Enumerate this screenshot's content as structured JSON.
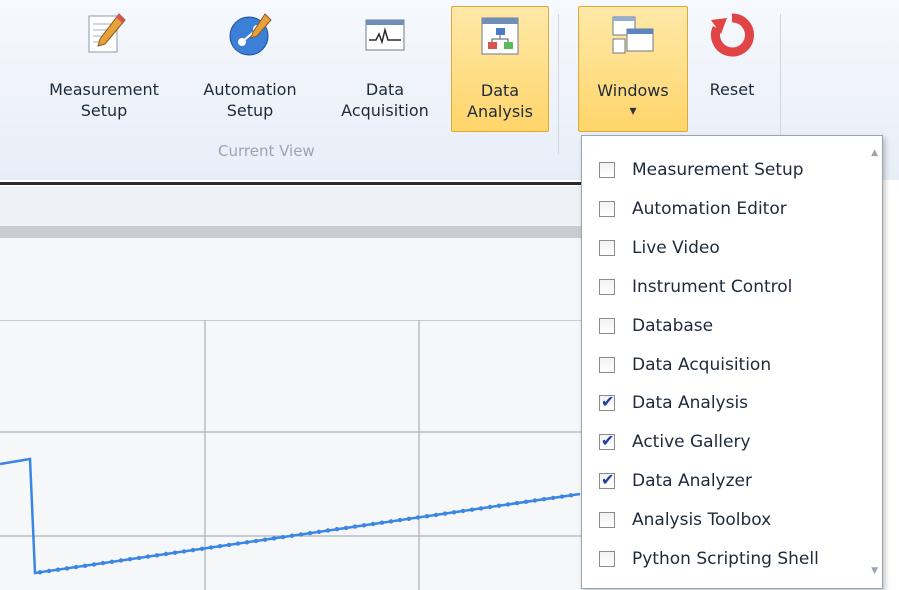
{
  "ribbon": {
    "buttons": [
      {
        "id": "measurement-setup",
        "label": "Measurement\nSetup"
      },
      {
        "id": "automation-setup",
        "label": "Automation\nSetup"
      },
      {
        "id": "data-acquisition",
        "label": "Data\nAcquisition"
      },
      {
        "id": "data-analysis",
        "label": "Data\nAnalysis",
        "active": true
      },
      {
        "id": "windows",
        "label": "Windows",
        "active": true,
        "dropdown_arrow": "▾"
      },
      {
        "id": "reset",
        "label": "Reset"
      }
    ],
    "group_label": "Current View"
  },
  "windows_menu": {
    "items": [
      {
        "label": "Measurement Setup",
        "checked": false
      },
      {
        "label": "Automation Editor",
        "checked": false
      },
      {
        "label": "Live Video",
        "checked": false
      },
      {
        "label": "Instrument Control",
        "checked": false
      },
      {
        "label": "Database",
        "checked": false
      },
      {
        "label": "Data Acquisition",
        "checked": false
      },
      {
        "label": "Data Analysis",
        "checked": true
      },
      {
        "label": "Active Gallery",
        "checked": true
      },
      {
        "label": "Data Analyzer",
        "checked": true
      },
      {
        "label": "Analysis Toolbox",
        "checked": false
      },
      {
        "label": "Python Scripting Shell",
        "checked": false
      }
    ],
    "check_glyph": "✔"
  },
  "colors": {
    "accent": "#ffd56a",
    "series": "#3b86e3",
    "checkmark": "#223e9e"
  }
}
